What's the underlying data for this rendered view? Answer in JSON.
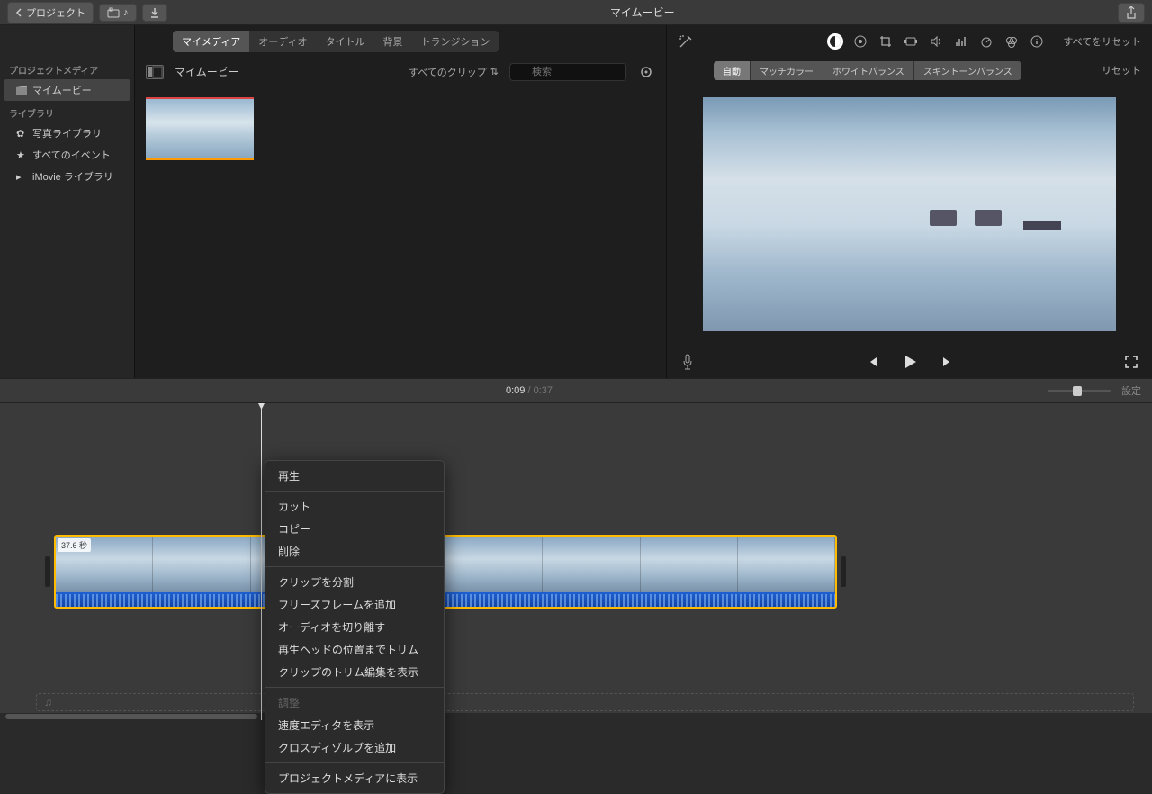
{
  "toolbar": {
    "back_label": "プロジェクト",
    "title": "マイムービー"
  },
  "sidebar": {
    "project_media_title": "プロジェクトメディア",
    "project_item": "マイムービー",
    "library_title": "ライブラリ",
    "photo_library": "写真ライブラリ",
    "all_events": "すべてのイベント",
    "imovie_library": "iMovie ライブラリ"
  },
  "media": {
    "tabs": [
      "マイメディア",
      "オーディオ",
      "タイトル",
      "背景",
      "トランジション"
    ],
    "active_tab": 0,
    "name": "マイムービー",
    "filter_label": "すべてのクリップ",
    "search_placeholder": "検索"
  },
  "preview": {
    "reset_all": "すべてをリセット",
    "adjust_tabs": [
      "自動",
      "マッチカラー",
      "ホワイトバランス",
      "スキントーンバランス"
    ],
    "reset": "リセット",
    "tool_icons": [
      "color-balance-icon",
      "color-wheel-icon",
      "crop-icon",
      "stabilize-icon",
      "volume-icon",
      "equalizer-icon",
      "speed-icon",
      "filter-icon",
      "info-icon"
    ]
  },
  "timeline": {
    "current": "0:09",
    "duration": "0:37",
    "settings": "設定",
    "clip_duration": "37.6 秒"
  },
  "context_menu": {
    "groups": [
      [
        "再生"
      ],
      [
        "カット",
        "コピー",
        "削除"
      ],
      [
        "クリップを分割",
        "フリーズフレームを追加",
        "オーディオを切り離す",
        "再生ヘッドの位置までトリム",
        "クリップのトリム編集を表示"
      ],
      [
        {
          "label": "調整",
          "disabled": true
        },
        "速度エディタを表示",
        "クロスディゾルブを追加"
      ],
      [
        "プロジェクトメディアに表示"
      ]
    ]
  }
}
